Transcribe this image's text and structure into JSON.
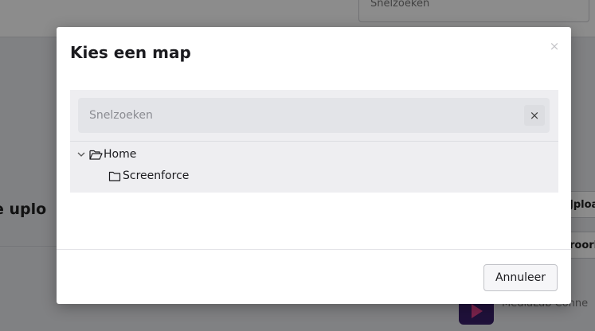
{
  "background": {
    "top_search_text": "Snelzoeken",
    "heading_fragment": "e uplo",
    "button_fragments": [
      "Jploa",
      "roork"
    ],
    "app_label_fragment": "MediaLab Conne"
  },
  "modal": {
    "title": "Kies een map",
    "close_glyph": "×",
    "search": {
      "placeholder": "Snelzoeken",
      "value": "",
      "clear_glyph": "×"
    },
    "tree": {
      "root": {
        "label": "Home",
        "expanded": true,
        "icon": "folder-open-icon"
      },
      "children": [
        {
          "label": "Screenforce",
          "icon": "folder-icon"
        }
      ]
    },
    "cancel_label": "Annuleer"
  },
  "colors": {
    "overlay": "#000000",
    "panel_background": "#eeeef1",
    "search_background": "#e3e4e8"
  }
}
